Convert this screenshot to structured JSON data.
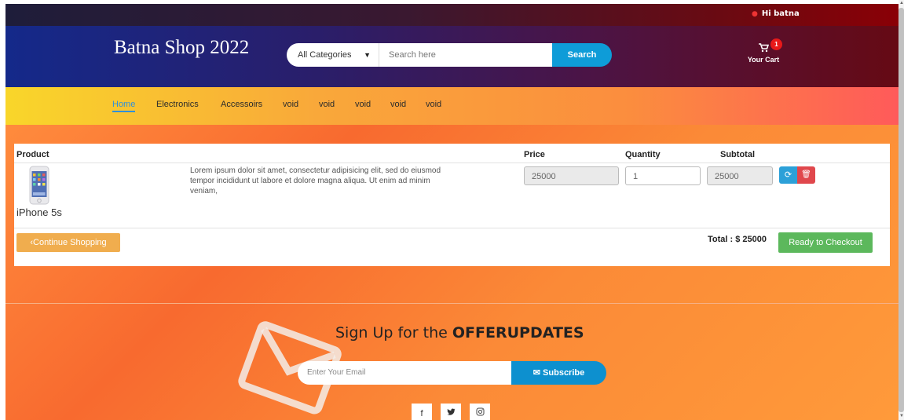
{
  "topbar": {
    "greeting": "Hi batna",
    "user_icon": "user-icon"
  },
  "header": {
    "brand": "Batna Shop 2022",
    "category_select": "All Categories",
    "search_placeholder": "Search here",
    "search_button": "Search",
    "cart_label": "Your Cart",
    "cart_count": "1"
  },
  "nav": {
    "items": [
      "Home",
      "Electronics",
      "Accessoirs",
      "void",
      "void",
      "void",
      "void",
      "void"
    ],
    "active": "Home"
  },
  "cart_table": {
    "headers": {
      "product": "Product",
      "price": "Price",
      "quantity": "Quantity",
      "subtotal": "Subtotal"
    },
    "rows": [
      {
        "name": "iPhone 5s",
        "description": "Lorem ipsum dolor sit amet, consectetur adipisicing elit, sed do eiusmod tempor incididunt ut labore et dolore magna aliqua. Ut enim ad minim veniam,",
        "price": "25000",
        "quantity": "1",
        "subtotal": "25000"
      }
    ],
    "continue_button": "Continue Shopping",
    "total": "Total : $ 25000",
    "checkout_button": "Ready to Checkout"
  },
  "newsletter": {
    "prefix": "Sign Up for the ",
    "highlight": "OFFERUPDATES",
    "email_placeholder": "Enter Your Email",
    "subscribe_button": "Subscribe",
    "social": [
      "facebook-icon",
      "twitter-icon",
      "instagram-icon"
    ]
  },
  "colors": {
    "accent_blue": "#0e9cd8",
    "checkout_green": "#5cb85c",
    "continue_orange": "#f0ad4e",
    "delete_red": "#e0474c"
  }
}
